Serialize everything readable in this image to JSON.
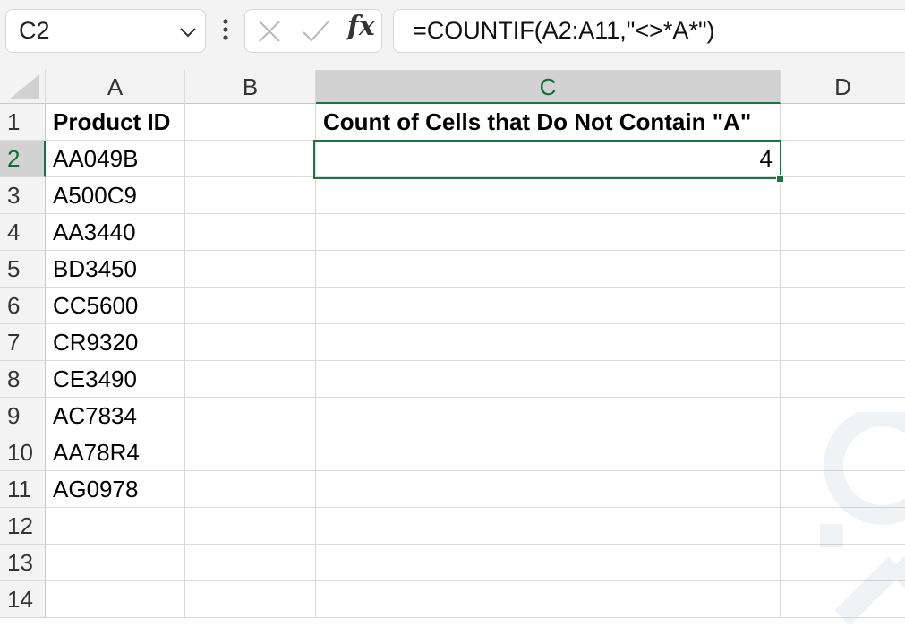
{
  "formula_bar": {
    "name_box": "C2",
    "formula": "=COUNTIF(A2:A11,\"<>*A*\")",
    "fx_label": "fx",
    "icons": {
      "dropdown": "chevron-down-icon",
      "grip": "vertical-ellipsis-icon",
      "cancel": "cancel-icon",
      "enter": "enter-check-icon"
    }
  },
  "grid": {
    "columns": [
      "A",
      "B",
      "C",
      "D"
    ],
    "selected_column": "C",
    "rows": [
      "1",
      "2",
      "3",
      "4",
      "5",
      "6",
      "7",
      "8",
      "9",
      "10",
      "11",
      "12",
      "13",
      "14"
    ],
    "selected_row": "2",
    "cells": {
      "A1": "Product ID",
      "A2": "AA049B",
      "A3": "A500C9",
      "A4": "AA3440",
      "A5": "BD3450",
      "A6": "CC5600",
      "A7": "CR9320",
      "A8": "CE3490",
      "A9": "AC7834",
      "A10": "AA78R4",
      "A11": "AG0978",
      "C1": "Count of Cells that Do Not Contain \"A\"",
      "C2": "4"
    }
  },
  "colors": {
    "accent_green": "#217346",
    "header_bg": "#f3f3f3",
    "selected_header_bg": "#d2d2d2"
  }
}
